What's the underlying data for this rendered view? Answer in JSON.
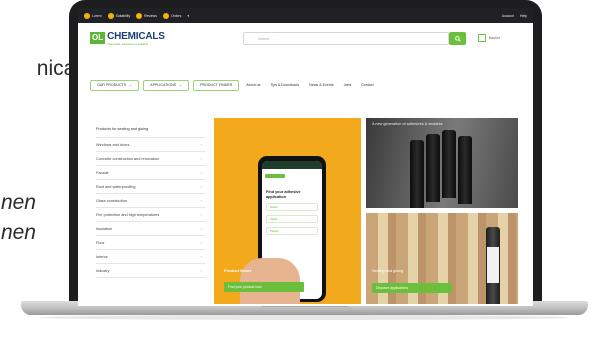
{
  "slide_text": {
    "line1": "nical",
    "line2": "nen",
    "line3": "nen"
  },
  "topbar": {
    "items": [
      "Lorem",
      "Suitability",
      "Reviews",
      "Orders",
      "▾"
    ],
    "right": [
      "Account",
      "Help"
    ]
  },
  "header": {
    "logo_badge": "OL",
    "logo_text": "CHEMICALS",
    "logo_sub": "Chemicals, adhesives & sealants",
    "search_placeholder": "Search…",
    "cart_label": "Basket"
  },
  "nav": {
    "dropdowns": [
      "OUR PRODUCTS",
      "APPLICATIONS",
      "PRODUCT FINDER"
    ],
    "links": [
      "About us",
      "Tips & Downloads",
      "News & Events",
      "Jobs",
      "Contact"
    ]
  },
  "sidebar": {
    "heading": "Products for sealing and gluing",
    "items": [
      "Windows and doors",
      "Concrete construction and renovation",
      "Facade",
      "Roof and waterproofing",
      "Glass construction",
      "Fire protection and high temperatures",
      "Insulation",
      "Floor",
      "Interior",
      "Industry"
    ]
  },
  "hero": {
    "phone_title": "Find your adhesive application",
    "phone_options": [
      "Glass",
      "Metal",
      "Plastic"
    ],
    "caption": "Product finder",
    "button": "Find your product now"
  },
  "panel1": {
    "title": "A new generation of adhesives & sealants"
  },
  "panel2": {
    "caption": "Sealing and gluing",
    "button": "Discover applications"
  },
  "colors": {
    "brand_green": "#6cbf3c",
    "brand_blue": "#1c3f74",
    "hero_yellow": "#f2a91c"
  }
}
